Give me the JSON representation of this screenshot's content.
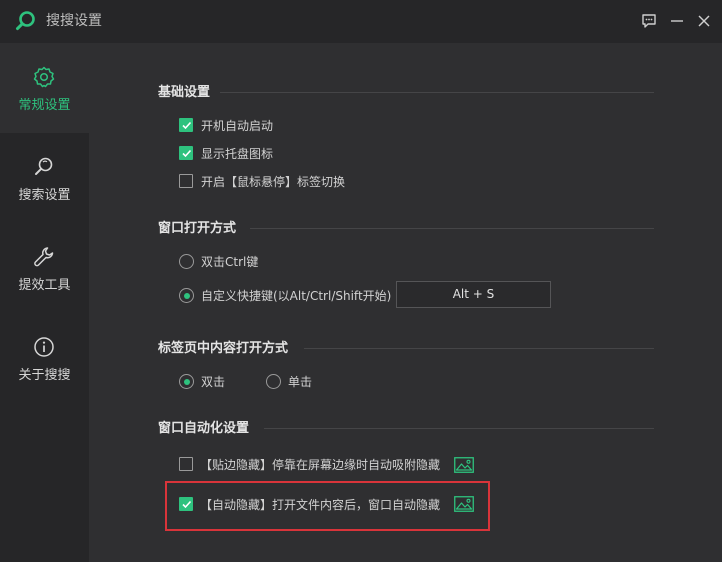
{
  "app": {
    "title": "搜搜设置",
    "accent_color": "#2ec27e",
    "icons": {
      "logo": "search-logo-icon",
      "feedback": "feedback-icon",
      "minimize": "minimize-icon",
      "close": "close-icon"
    }
  },
  "sidebar": {
    "items": [
      {
        "label": "常规设置",
        "icon": "gear-icon",
        "active": true
      },
      {
        "label": "搜索设置",
        "icon": "search-icon",
        "active": false
      },
      {
        "label": "提效工具",
        "icon": "wrench-icon",
        "active": false
      },
      {
        "label": "关于搜搜",
        "icon": "info-icon",
        "active": false
      }
    ]
  },
  "basic": {
    "title": "基础设置",
    "options": [
      {
        "label": "开机自动启动",
        "checked": true
      },
      {
        "label": "显示托盘图标",
        "checked": true
      },
      {
        "label": "开启【鼠标悬停】标签切换",
        "checked": false
      }
    ]
  },
  "window_open": {
    "title": "窗口打开方式",
    "options": [
      {
        "label": "双击Ctrl键",
        "selected": false
      },
      {
        "label": "自定义快捷键(以Alt/Ctrl/Shift开始)",
        "selected": true
      }
    ],
    "hotkey_value": "Alt + S"
  },
  "tab_open": {
    "title": "标签页中内容打开方式",
    "options": [
      {
        "label": "双击",
        "selected": true
      },
      {
        "label": "单击",
        "selected": false
      }
    ]
  },
  "auto_window": {
    "title": "窗口自动化设置",
    "options": [
      {
        "label": "【贴边隐藏】停靠在屏幕边缘时自动吸附隐藏",
        "checked": false,
        "preview_icon": "image-preview-icon"
      },
      {
        "label": "【自动隐藏】打开文件内容后，窗口自动隐藏",
        "checked": true,
        "preview_icon": "image-preview-icon",
        "highlighted": true
      }
    ],
    "highlight_color": "#d9343a"
  }
}
